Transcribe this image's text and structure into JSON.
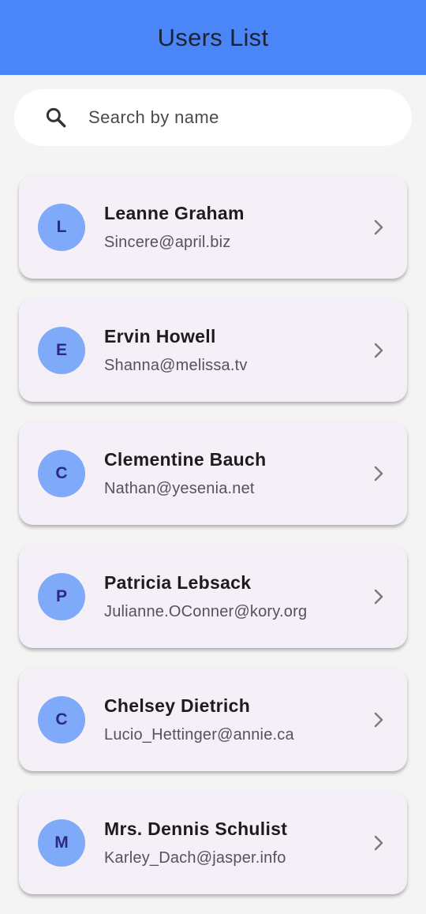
{
  "app_bar": {
    "title": "Users List",
    "color": "#4a86f7"
  },
  "search": {
    "placeholder": "Search by name",
    "value": "",
    "icon": "search-icon"
  },
  "users": [
    {
      "initial": "L",
      "name": "Leanne Graham",
      "email": "Sincere@april.biz"
    },
    {
      "initial": "E",
      "name": "Ervin Howell",
      "email": "Shanna@melissa.tv"
    },
    {
      "initial": "C",
      "name": "Clementine Bauch",
      "email": "Nathan@yesenia.net"
    },
    {
      "initial": "P",
      "name": "Patricia Lebsack",
      "email": "Julianne.OConner@kory.org"
    },
    {
      "initial": "C",
      "name": "Chelsey Dietrich",
      "email": "Lucio_Hettinger@annie.ca"
    },
    {
      "initial": "M",
      "name": "Mrs. Dennis Schulist",
      "email": "Karley_Dach@jasper.info"
    }
  ],
  "colors": {
    "avatar_bg": "#7faaf9",
    "avatar_text": "#2c2a7c",
    "card_bg": "#f5f0f8"
  },
  "row_icon": "chevron-right-icon"
}
